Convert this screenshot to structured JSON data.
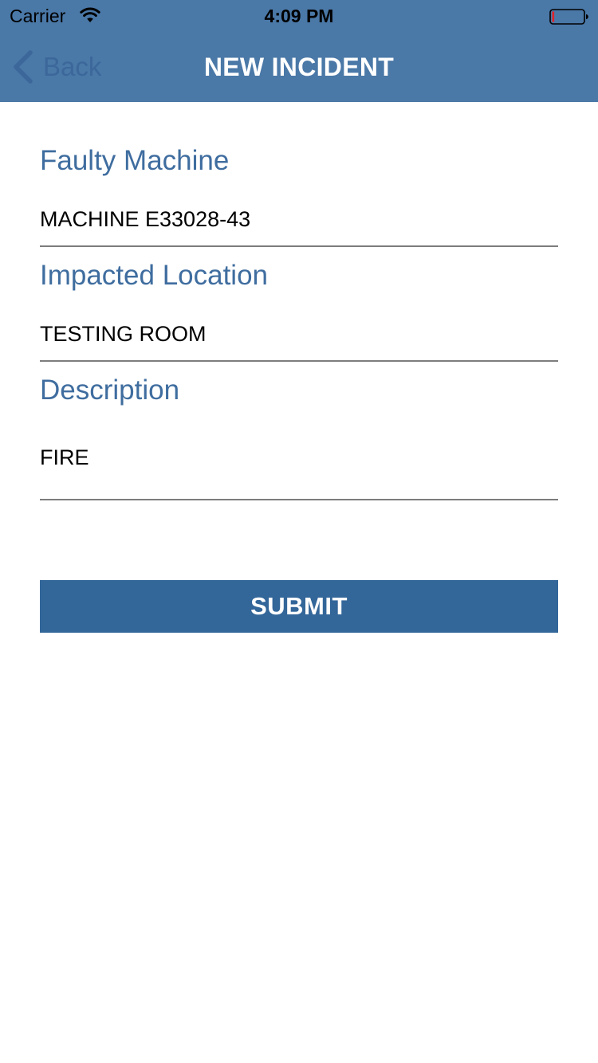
{
  "status_bar": {
    "carrier": "Carrier",
    "time": "4:09 PM"
  },
  "nav": {
    "back_label": "Back",
    "title": "NEW INCIDENT"
  },
  "form": {
    "fields": [
      {
        "label": "Faulty Machine",
        "value": "MACHINE E33028-43"
      },
      {
        "label": "Impacted Location",
        "value": "TESTING ROOM"
      },
      {
        "label": "Description",
        "value": "FIRE"
      }
    ],
    "submit_label": "SUBMIT"
  },
  "colors": {
    "nav_background": "#4a78a7",
    "label_text": "#3f6d9f",
    "button_background": "#336699",
    "battery_low": "#e0242a"
  },
  "icons": {
    "wifi": "wifi-icon",
    "battery": "battery-icon",
    "back": "chevron-left-icon"
  }
}
